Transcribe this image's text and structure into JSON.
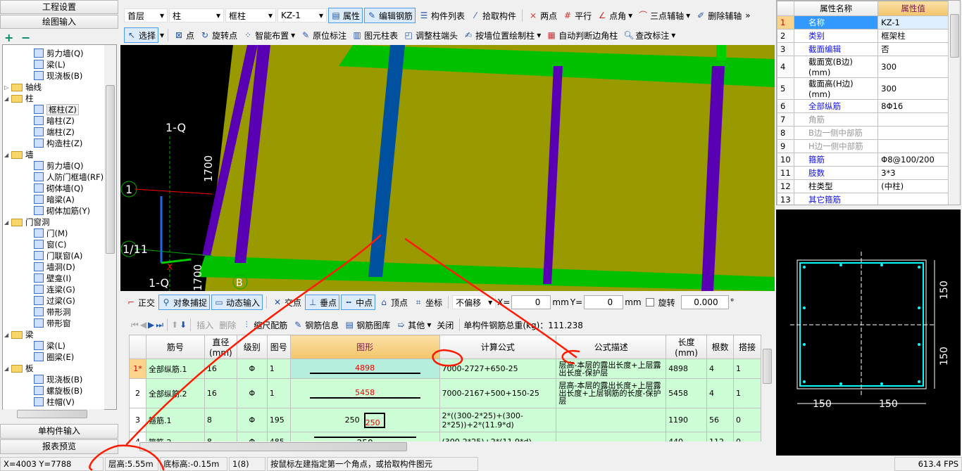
{
  "left_panel": {
    "tab_project_settings": "工程设置",
    "tab_drawing_input": "绘图输入",
    "expand_all": "+",
    "collapse_all": "−",
    "tree": [
      {
        "label": "剪力墙(Q)",
        "level": 2
      },
      {
        "label": "梁(L)",
        "level": 2
      },
      {
        "label": "现浇板(B)",
        "level": 2
      },
      {
        "label": "轴线",
        "level": 1,
        "folder": true,
        "expanded": false
      },
      {
        "label": "柱",
        "level": 1,
        "folder": true,
        "expanded": true
      },
      {
        "label": "框柱(Z)",
        "level": 2,
        "selected": true
      },
      {
        "label": "暗柱(Z)",
        "level": 2
      },
      {
        "label": "端柱(Z)",
        "level": 2
      },
      {
        "label": "构造柱(Z)",
        "level": 2
      },
      {
        "label": "墙",
        "level": 1,
        "folder": true,
        "expanded": true
      },
      {
        "label": "剪力墙(Q)",
        "level": 2
      },
      {
        "label": "人防门框墙(RF)",
        "level": 2
      },
      {
        "label": "砌体墙(Q)",
        "level": 2
      },
      {
        "label": "暗梁(A)",
        "level": 2
      },
      {
        "label": "砌体加筋(Y)",
        "level": 2
      },
      {
        "label": "门窗洞",
        "level": 1,
        "folder": true,
        "expanded": true
      },
      {
        "label": "门(M)",
        "level": 2
      },
      {
        "label": "窗(C)",
        "level": 2
      },
      {
        "label": "门联窗(A)",
        "level": 2
      },
      {
        "label": "墙洞(D)",
        "level": 2
      },
      {
        "label": "壁龛(I)",
        "level": 2
      },
      {
        "label": "连梁(G)",
        "level": 2
      },
      {
        "label": "过梁(G)",
        "level": 2
      },
      {
        "label": "带形洞",
        "level": 2
      },
      {
        "label": "带形窗",
        "level": 2
      },
      {
        "label": "梁",
        "level": 1,
        "folder": true,
        "expanded": true
      },
      {
        "label": "梁(L)",
        "level": 2
      },
      {
        "label": "圈梁(E)",
        "level": 2
      },
      {
        "label": "板",
        "level": 1,
        "folder": true,
        "expanded": true
      },
      {
        "label": "现浇板(B)",
        "level": 2
      },
      {
        "label": "螺旋板(B)",
        "level": 2
      },
      {
        "label": "柱帽(V)",
        "level": 2
      }
    ],
    "tab_single_component": "单构件输入",
    "tab_report_preview": "报表预览"
  },
  "toolbar1": {
    "floor": "首层",
    "type": "柱",
    "subtype": "框柱",
    "component": "KZ-1",
    "properties": "属性",
    "edit_rebar": "编辑钢筋",
    "component_list": "构件列表",
    "pick_component": "拾取构件",
    "two_points": "两点",
    "parallel": "平行",
    "point_angle": "点角",
    "three_point_axis": "三点辅轴",
    "delete_axis": "删除辅轴"
  },
  "toolbar2": {
    "select": "选择",
    "point": "点",
    "rotate_point": "旋转点",
    "smart_layout": "智能布置",
    "in_place_label": "原位标注",
    "column_table": "图元柱表",
    "adjust_column_end": "调整柱端头",
    "draw_by_wall": "按墙位置绘制柱",
    "auto_corner": "自动判断边角柱",
    "edit_label": "查改标注"
  },
  "canvas": {
    "axis_labels": [
      "1-Q",
      "1",
      "1/11",
      "1-Q",
      "B"
    ],
    "dimension": "1700",
    "dimension2": "1700"
  },
  "snap_toolbar": {
    "ortho": "正交",
    "object_snap": "对象捕捉",
    "dynamic_input": "动态输入",
    "intersection": "交点",
    "perpendicular": "垂点",
    "midpoint": "中点",
    "vertex": "顶点",
    "coordinate": "坐标",
    "offset_mode": "不偏移",
    "x_label": "X=",
    "x_value": "0",
    "mm1": "mm",
    "y_label": "Y=",
    "y_value": "0",
    "mm2": "mm",
    "rotate_label": "旋转",
    "rotate_value": "0.000",
    "degree": "°"
  },
  "rebar_toolbar": {
    "insert": "插入",
    "delete": "删除",
    "scale_rebar": "缩尺配筋",
    "rebar_info": "钢筋信息",
    "rebar_library": "钢筋图库",
    "other": "其他",
    "close": "关闭",
    "total_weight": "单构件钢筋总重(kg)：111.238"
  },
  "rebar_table": {
    "columns": [
      "",
      "筋号",
      "直径(mm)",
      "级别",
      "图号",
      "图形",
      "计算公式",
      "公式描述",
      "长度(mm)",
      "根数",
      "搭接"
    ],
    "rows": [
      {
        "idx": "1*",
        "name": "全部纵筋.1",
        "dia": "16",
        "grade": "Φ",
        "fig": "1",
        "shape_value": "4898",
        "formula": "7000-2727+650-25",
        "desc": "层高-本层的露出长度+上层露出长度-保护层",
        "length": "4898",
        "count": "4",
        "lap": "1"
      },
      {
        "idx": "2",
        "name": "全部纵筋.2",
        "dia": "16",
        "grade": "Φ",
        "fig": "1",
        "shape_value": "5458",
        "formula": "7000-2167+500+150-25",
        "desc": "层高-本层的露出长度+上层露出长度+上层钢筋的长度-保护层",
        "length": "5458",
        "count": "4",
        "lap": "1"
      },
      {
        "idx": "3",
        "name": "箍筋.1",
        "dia": "8",
        "grade": "Φ",
        "fig": "195",
        "shape_value": "250",
        "shape_value2": "250",
        "formula": "2*((300-2*25)+(300-2*25))+2*(11.9*d)",
        "desc": "",
        "length": "1190",
        "count": "56",
        "lap": "0"
      },
      {
        "idx": "4",
        "name": "箍筋.2",
        "dia": "8",
        "grade": "Φ",
        "fig": "485",
        "shape_value": "250",
        "formula": "(300-2*25)+2*(11.9*d)",
        "desc": "",
        "length": "440",
        "count": "112",
        "lap": "0"
      }
    ]
  },
  "properties": {
    "header_name": "属性名称",
    "header_value": "属性值",
    "rows": [
      {
        "n": "1",
        "name": "名称",
        "value": "KZ-1",
        "style": "selected"
      },
      {
        "n": "2",
        "name": "类别",
        "value": "框架柱",
        "style": "link"
      },
      {
        "n": "3",
        "name": "截面编辑",
        "value": "否",
        "style": "link"
      },
      {
        "n": "4",
        "name": "截面宽(B边)(mm)",
        "value": "300",
        "style": ""
      },
      {
        "n": "5",
        "name": "截面高(H边)(mm)",
        "value": "300",
        "style": ""
      },
      {
        "n": "6",
        "name": "全部纵筋",
        "value": "8Φ16",
        "style": "link"
      },
      {
        "n": "7",
        "name": "角筋",
        "value": "",
        "style": "gray"
      },
      {
        "n": "8",
        "name": "B边一侧中部筋",
        "value": "",
        "style": "gray"
      },
      {
        "n": "9",
        "name": "H边一侧中部筋",
        "value": "",
        "style": "gray"
      },
      {
        "n": "10",
        "name": "箍筋",
        "value": "Φ8@100/200",
        "style": "link"
      },
      {
        "n": "11",
        "name": "肢数",
        "value": "3*3",
        "style": "link"
      },
      {
        "n": "12",
        "name": "柱类型",
        "value": "(中柱)",
        "style": ""
      },
      {
        "n": "13",
        "name": "其它箍筋",
        "value": "",
        "style": "link"
      },
      {
        "n": "14",
        "name": "备注",
        "value": "",
        "style": ""
      }
    ]
  },
  "section_preview": {
    "dim_right_top": "150",
    "dim_right_bottom": "150",
    "dim_bottom_left": "150",
    "dim_bottom_right": "150"
  },
  "status_bar": {
    "coords": "X=4003 Y=7788",
    "floor_height": "层高:5.55m",
    "base_elevation": "底标高:-0.15m",
    "count": "1(8)",
    "hint": "按鼠标左建指定第一个角点，或拾取构件图元",
    "fps": "613.4 FPS"
  },
  "colors": {
    "olive": "#999900",
    "green": "#00c000",
    "purple": "#5a00b4",
    "blue_col": "#0050a0",
    "annotation": "#ff1a00",
    "grid_row": "#ccfdd5"
  }
}
